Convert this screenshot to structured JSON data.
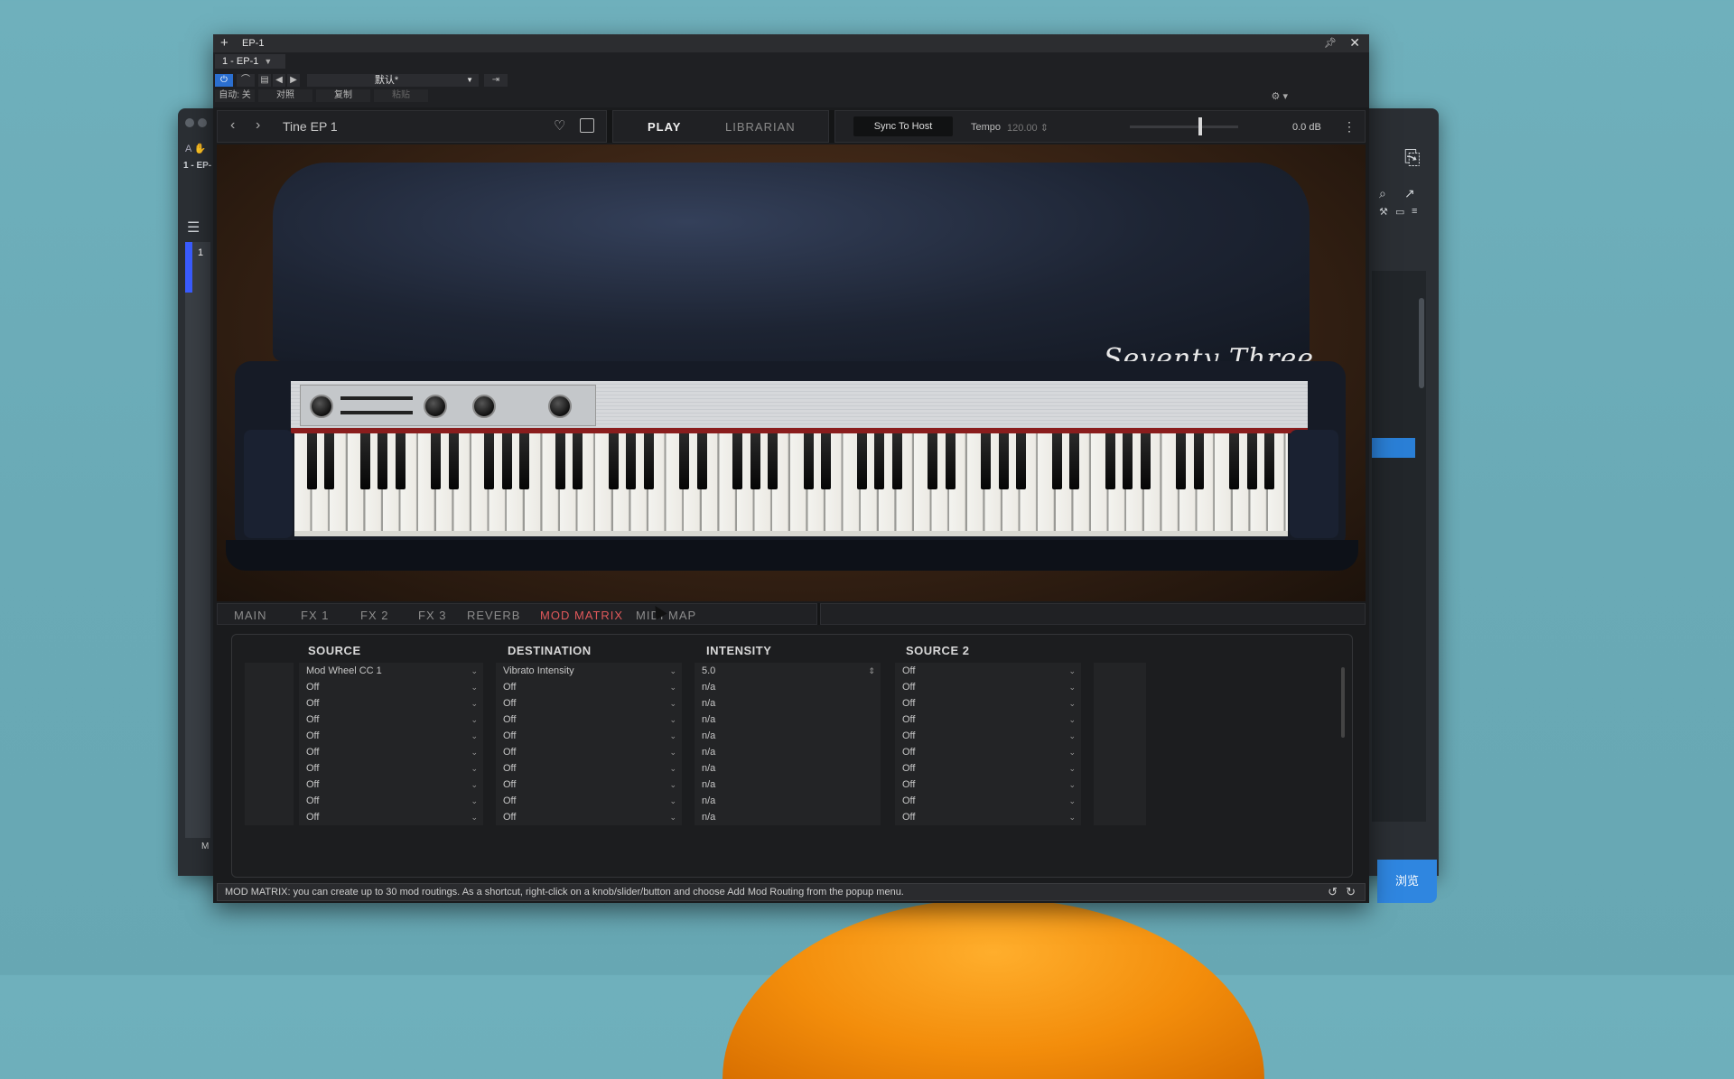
{
  "host": {
    "track_label": "1 - EP-",
    "lane_number": "1",
    "m_label": "M",
    "browse_label": "浏览"
  },
  "window": {
    "title": "EP-1",
    "instrument_select": "1 - EP-1",
    "preset": "默认*",
    "auto_label": "自动: 关",
    "compare_label": "对照",
    "copy_label": "复制",
    "paste_label": "粘贴"
  },
  "header": {
    "preset_name": "Tine EP 1",
    "tab_play": "PLAY",
    "tab_librarian": "LIBRARIAN",
    "sync_label": "Sync To Host",
    "tempo_label": "Tempo",
    "tempo_value": "120.00",
    "volume_value": "0.0 dB"
  },
  "brand": "Seventy Three",
  "tabs": [
    "MAIN",
    "FX 1",
    "FX 2",
    "FX 3",
    "REVERB",
    "MOD MATRIX",
    "MIDI MAP"
  ],
  "active_tab": "MOD MATRIX",
  "matrix": {
    "headers": {
      "source": "SOURCE",
      "destination": "DESTINATION",
      "intensity": "INTENSITY",
      "source2": "SOURCE 2"
    },
    "rows": [
      {
        "source": "Mod Wheel CC 1",
        "destination": "Vibrato Intensity",
        "intensity": "5.0",
        "source2": "Off"
      },
      {
        "source": "Off",
        "destination": "Off",
        "intensity": "n/a",
        "source2": "Off"
      },
      {
        "source": "Off",
        "destination": "Off",
        "intensity": "n/a",
        "source2": "Off"
      },
      {
        "source": "Off",
        "destination": "Off",
        "intensity": "n/a",
        "source2": "Off"
      },
      {
        "source": "Off",
        "destination": "Off",
        "intensity": "n/a",
        "source2": "Off"
      },
      {
        "source": "Off",
        "destination": "Off",
        "intensity": "n/a",
        "source2": "Off"
      },
      {
        "source": "Off",
        "destination": "Off",
        "intensity": "n/a",
        "source2": "Off"
      },
      {
        "source": "Off",
        "destination": "Off",
        "intensity": "n/a",
        "source2": "Off"
      },
      {
        "source": "Off",
        "destination": "Off",
        "intensity": "n/a",
        "source2": "Off"
      },
      {
        "source": "Off",
        "destination": "Off",
        "intensity": "n/a",
        "source2": "Off"
      }
    ]
  },
  "status_text": "MOD MATRIX: you can create up to 30 mod routings. As a shortcut, right-click on a knob/slider/button and choose Add Mod Routing from the popup menu.",
  "colors": {
    "accent_active_tab": "#e0585a",
    "host_blue": "#2f86e0"
  }
}
